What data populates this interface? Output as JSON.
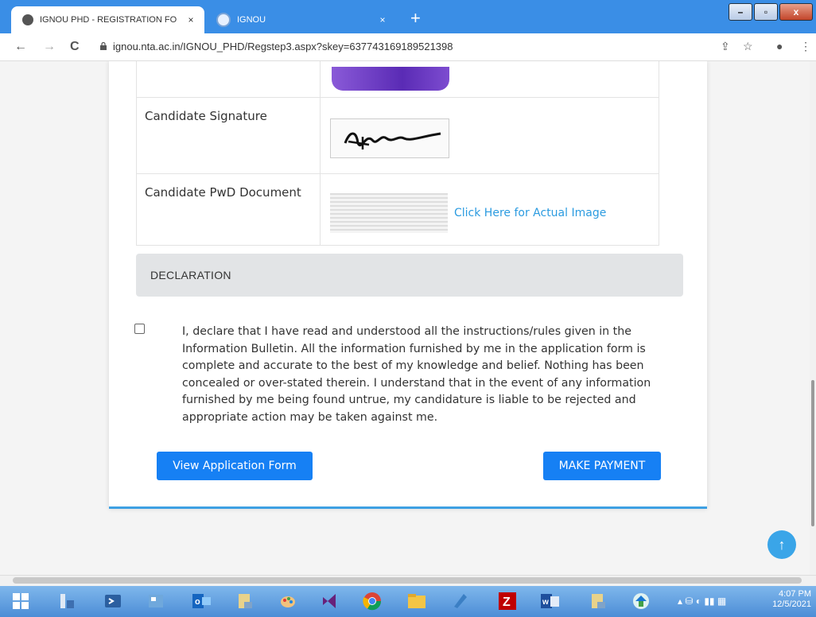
{
  "browser": {
    "tabs": [
      {
        "title": "IGNOU PHD - REGISTRATION FO",
        "close": "×",
        "active": true
      },
      {
        "title": "IGNOU",
        "close": "×",
        "active": false
      }
    ],
    "new_tab": "+",
    "url": "ignou.nta.ac.in/IGNOU_PHD/Regstep3.aspx?skey=637743169189521398",
    "window_buttons": {
      "minimize": "–",
      "maximize": "▫",
      "close": "x"
    },
    "nav": {
      "back": "←",
      "forward": "→",
      "reload": "C"
    },
    "toolbar_right": {
      "share": "⇪",
      "bookmark": "☆",
      "profile": "●",
      "menu": "⋮"
    }
  },
  "documents": [
    {
      "label": "",
      "type": "photo"
    },
    {
      "label": "Candidate Signature",
      "type": "signature"
    },
    {
      "label": "Candidate PwD Document",
      "type": "pwd",
      "link": "Click Here for Actual Image"
    }
  ],
  "declaration": {
    "heading": "DECLARATION",
    "checked": false,
    "text": "I, declare that I have read and understood all the instructions/rules given in the Information Bulletin. All the information furnished by me in the application form is complete and accurate to the best of my knowledge and belief. Nothing has been concealed or over-stated therein. I understand that in the event of any information furnished by me being found untrue, my candidature is liable to be rejected and appropriate action may be taken against me."
  },
  "buttons": {
    "view_form": "View Application Form",
    "make_payment": "MAKE PAYMENT"
  },
  "scroll_top": "↑",
  "taskbar": {
    "time": "4:07 PM",
    "date": "12/5/2021"
  },
  "colors": {
    "primary": "#1680f4",
    "link": "#2b9be0",
    "accent_border": "#3ea0e3",
    "chrome": "#3a8ee6"
  }
}
